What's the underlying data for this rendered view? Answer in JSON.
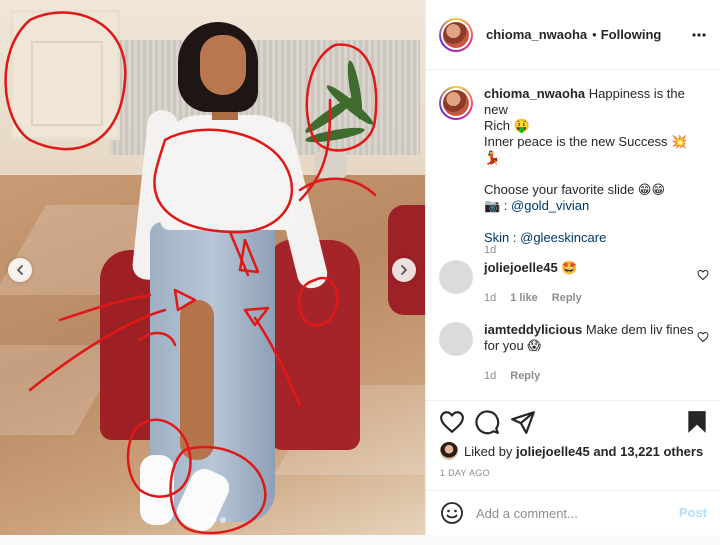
{
  "post": {
    "username": "chioma_nwaoha",
    "follow_status": "Following",
    "caption_lines": [
      "Happiness is the new",
      "Rich 🤑",
      "Inner peace is the new Success 💥💃",
      "",
      "Choose your favorite slide 😁😁",
      "📷 : @gold_vivian",
      "",
      "Skin : @gleeskincare"
    ],
    "caption_age": "1d",
    "likes_prefix": "Liked by",
    "liked_by_user": "joliejoelle45",
    "likes_suffix": "and 13,221 others",
    "date": "1 DAY AGO",
    "carousel": {
      "total_slides": 3,
      "active_slide": 2
    }
  },
  "comments": [
    {
      "user": "joliejoelle45",
      "text": "🤩",
      "age": "1d",
      "likes": "1 like",
      "reply": "Reply"
    },
    {
      "user": "iamteddylicious",
      "text": "Make dem liv fines for you 😱",
      "age": "1d",
      "likes": "",
      "reply": "Reply"
    }
  ],
  "comment_box": {
    "placeholder": "Add a comment...",
    "post_label": "Post"
  },
  "icons": {
    "more": "more-horizontal-icon",
    "like": "heart-icon",
    "comment": "comment-bubble-icon",
    "share": "paper-plane-icon",
    "save": "bookmark-icon",
    "emoji": "smiley-icon",
    "prev": "chevron-left-icon",
    "next": "chevron-right-icon"
  },
  "colors": {
    "link": "#00376b",
    "muted": "#8e8e8e",
    "post_button": "#b2dffc",
    "annotation": "#e01818"
  }
}
